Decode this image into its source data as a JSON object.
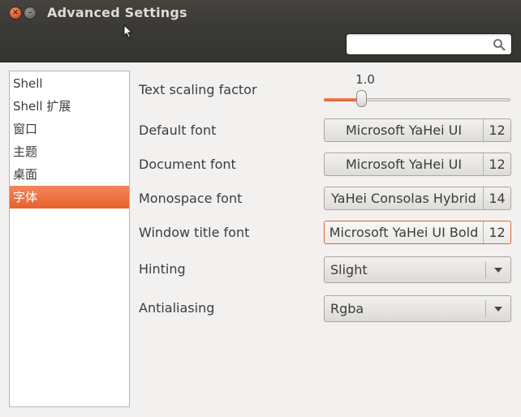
{
  "window": {
    "title": "Advanced Settings",
    "close_symbol": "×",
    "minimize_symbol": "–"
  },
  "search": {
    "value": "",
    "placeholder": ""
  },
  "sidebar": {
    "items": [
      {
        "label": "Shell"
      },
      {
        "label": "Shell 扩展"
      },
      {
        "label": "窗口"
      },
      {
        "label": "主题"
      },
      {
        "label": "桌面"
      },
      {
        "label": "字体",
        "selected": true
      }
    ]
  },
  "settings": {
    "text_scaling": {
      "label": "Text scaling factor",
      "value": "1.0",
      "slider_fraction": 0.2
    },
    "default_font": {
      "label": "Default font",
      "font": "Microsoft YaHei UI",
      "size": "12"
    },
    "document_font": {
      "label": "Document font",
      "font": "Microsoft YaHei UI",
      "size": "12"
    },
    "monospace_font": {
      "label": "Monospace font",
      "font": "YaHei Consolas Hybrid",
      "size": "14"
    },
    "window_title_font": {
      "label": "Window title font",
      "font": "Microsoft YaHei UI Bold",
      "size": "12"
    },
    "hinting": {
      "label": "Hinting",
      "value": "Slight"
    },
    "antialiasing": {
      "label": "Antialiasing",
      "value": "Rgba"
    }
  },
  "colors": {
    "accent": "#e7612e",
    "titlebar": "#3b3a36",
    "background": "#f2f1f0"
  },
  "icons": {
    "search": "search-icon",
    "dropdown": "dropdown-arrow-icon",
    "cursor": "mouse-pointer-icon"
  }
}
